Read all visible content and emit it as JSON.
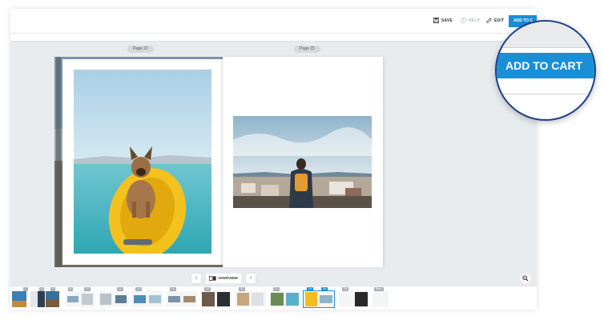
{
  "toolbar": {
    "save_label": "SAVE",
    "help_label": "HELP",
    "edit_label": "EDIT",
    "cart_label": "ADD TO C",
    "icons": {
      "save": "floppy-disk-icon",
      "help": "question-circle-icon",
      "edit": "pencil-icon"
    }
  },
  "pages": {
    "left_label": "Page 22",
    "right_label": "Page 23"
  },
  "pagenav": {
    "prev": "‹",
    "next": "›",
    "overview_label": "OVERVIEW"
  },
  "thumbnails": [
    {
      "num": "2"
    },
    {
      "num": "4"
    },
    {
      "num": "6"
    },
    {
      "num": "8"
    },
    {
      "num": "10"
    },
    {
      "num": "12"
    },
    {
      "num": "14"
    },
    {
      "num": "16"
    },
    {
      "num": "18"
    },
    {
      "num": "20"
    },
    {
      "num": "22"
    },
    {
      "num": "24"
    },
    {
      "num": "26"
    },
    {
      "num": "28"
    },
    {
      "num": "Back"
    }
  ],
  "magnifier": {
    "cart_label": "ADD TO CART"
  },
  "colors": {
    "accent": "#1a8fd6",
    "ring": "#1b3f86",
    "workspace": "#e8ebee"
  }
}
